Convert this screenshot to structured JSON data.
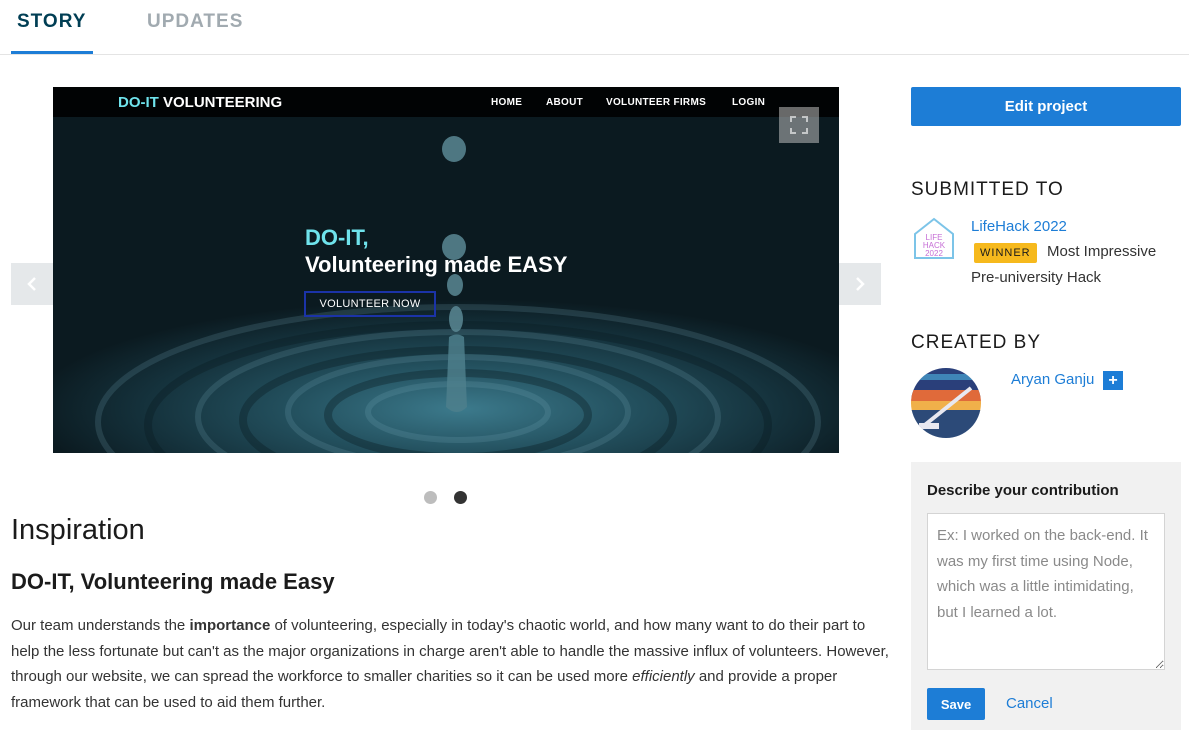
{
  "tabs": [
    {
      "label": "STORY",
      "active": true
    },
    {
      "label": "UPDATES",
      "active": false
    }
  ],
  "carousel": {
    "slide": {
      "brand_accent": "DO-IT",
      "brand_rest": " VOLUNTEERING",
      "nav": [
        "HOME",
        "ABOUT",
        "VOLUNTEER FIRMS",
        "LOGIN"
      ],
      "hero_line1": "DO-IT,",
      "hero_line2": "Volunteering made EASY",
      "hero_button": "VOLUNTEER NOW"
    },
    "slide_count": 2,
    "active_slide": 2,
    "icons": {
      "prev": "chevron-left-icon",
      "next": "chevron-right-icon",
      "expand": "expand-icon"
    }
  },
  "story": {
    "heading": "Inspiration",
    "subheading": "DO-IT, Volunteering made Easy",
    "paragraph": {
      "part1": "Our team understands the ",
      "bold": "importance",
      "part2": " of volunteering, especially in today's chaotic world, and how many want to do their part to help the less fortunate but can't as the major organizations in charge aren't able to handle the massive influx of volunteers. However, through our website, we can spread the workforce to smaller charities so it can be used more ",
      "italic": "efficiently",
      "part3": " and provide a proper framework that can be used to aid them further."
    }
  },
  "sidebar": {
    "edit_button": "Edit project",
    "submitted_heading": "SUBMITTED TO",
    "hackathon": {
      "name": "LifeHack 2022",
      "logo_text_1": "LIFE",
      "logo_text_2": "HACK",
      "logo_text_3": "2022",
      "badge": "WINNER",
      "prize_line1": "Most Impressive",
      "prize_line2": "Pre-university Hack"
    },
    "created_heading": "CREATED BY",
    "author": {
      "name": "Aryan Ganju",
      "follow_icon": "plus-icon",
      "follow_symbol": "+"
    },
    "contribution": {
      "title": "Describe your contribution",
      "placeholder": "Ex: I worked on the back-end. It was my first time using Node, which was a little intimidating, but I learned a lot.",
      "save": "Save",
      "cancel": "Cancel"
    }
  },
  "colors": {
    "accent": "#1d7dd6",
    "winner": "#f6b91d",
    "brand_cyan": "#6fe3ec",
    "tab_active": "#003e54"
  }
}
